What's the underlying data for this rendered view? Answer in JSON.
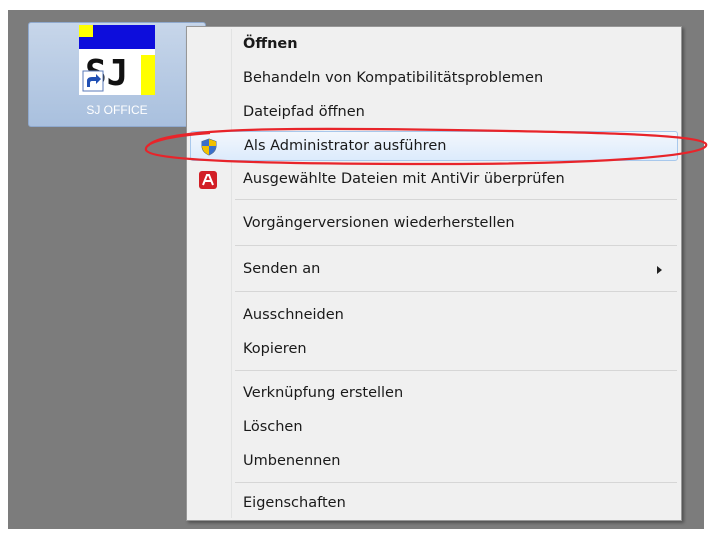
{
  "desktop": {
    "icon_label": "SJ OFFICE",
    "icon_glyph_text": "SJ"
  },
  "context_menu": {
    "items": [
      {
        "label": "Öffnen",
        "bold": true,
        "icon": null
      },
      {
        "label": "Behandeln von Kompatibilitätsproblemen",
        "icon": null
      },
      {
        "label": "Dateipfad öffnen",
        "icon": null
      },
      {
        "label": "Als Administrator ausführen",
        "icon": "uac-shield-icon",
        "highlighted": true
      },
      {
        "label": "Ausgewählte Dateien mit AntiVir überprüfen",
        "icon": "antivir-icon"
      },
      {
        "label": "Vorgängerversionen wiederherstellen",
        "icon": null
      },
      {
        "label": "Senden an",
        "icon": null,
        "submenu": true
      },
      {
        "label": "Ausschneiden",
        "icon": null
      },
      {
        "label": "Kopieren",
        "icon": null
      },
      {
        "label": "Verknüpfung erstellen",
        "icon": null
      },
      {
        "label": "Löschen",
        "icon": null
      },
      {
        "label": "Umbenennen",
        "icon": null
      },
      {
        "label": "Eigenschaften",
        "icon": null
      }
    ]
  },
  "colors": {
    "desktop_bg": "#7c7c7c",
    "menu_bg": "#f0f0f0",
    "highlight_border": "#a8c8ec",
    "annotation_red": "#e8242a"
  }
}
